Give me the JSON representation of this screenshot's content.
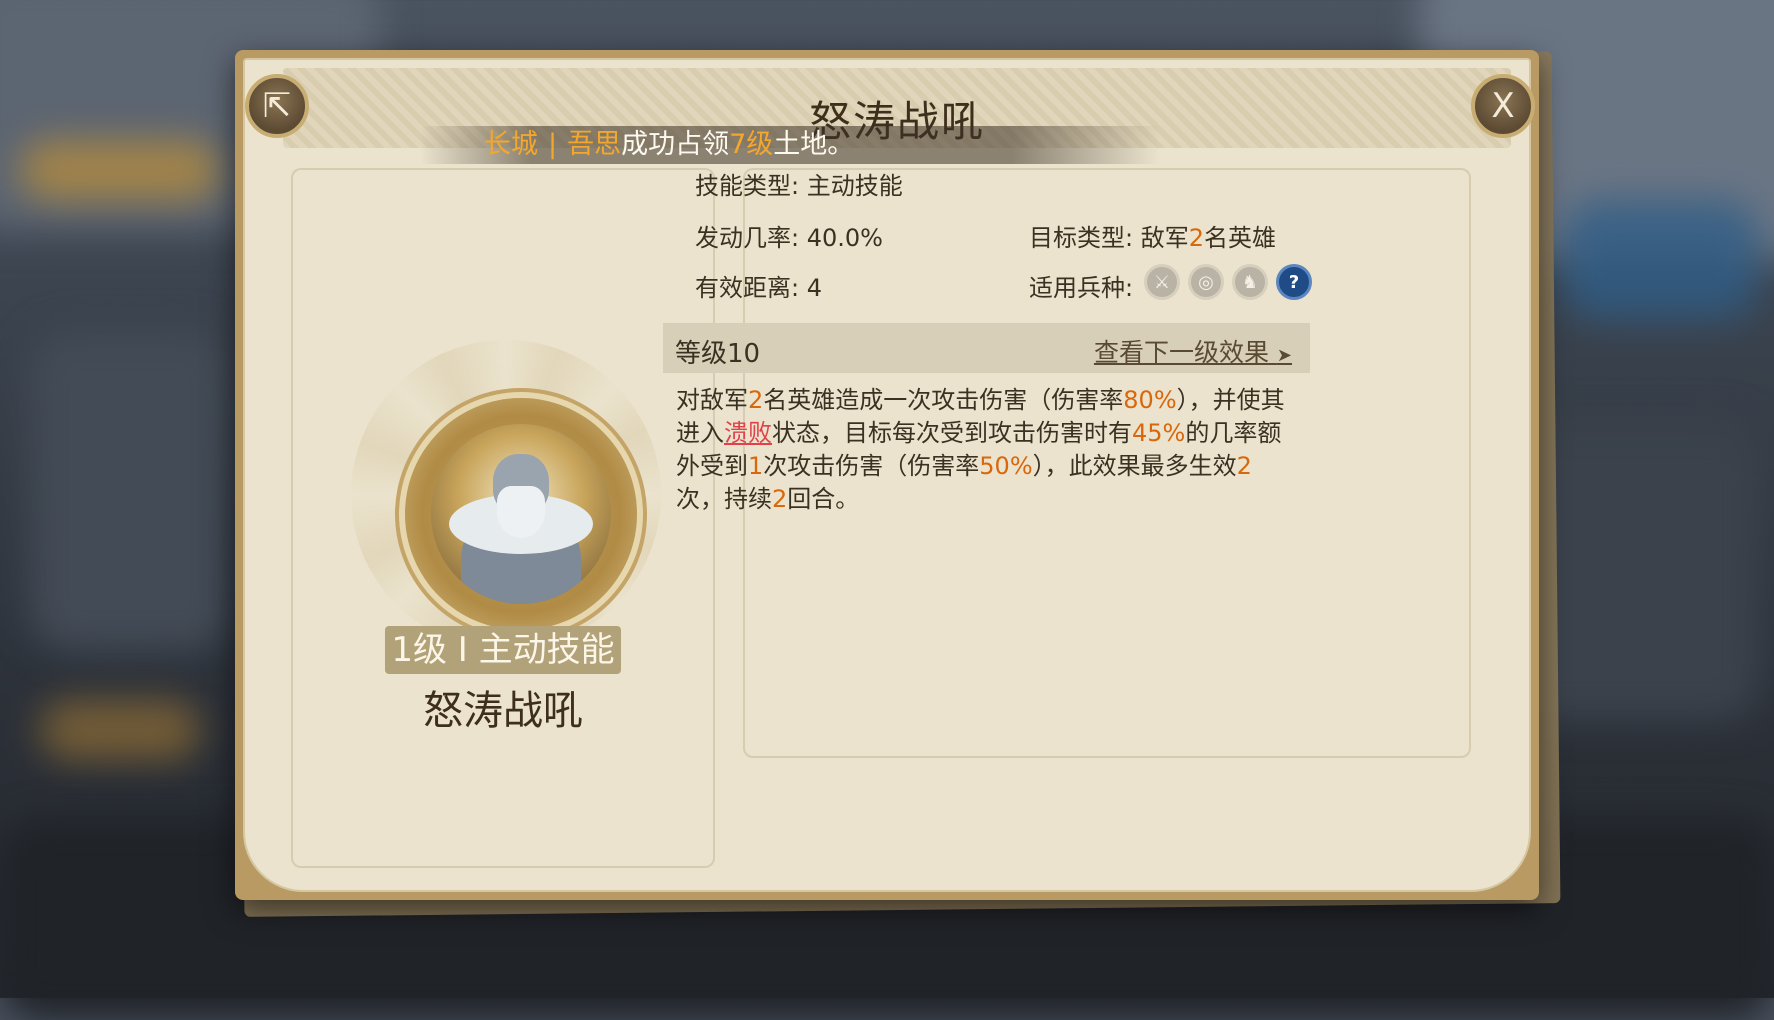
{
  "window": {
    "title": "怒涛战吼"
  },
  "header": {
    "share_icon": "share-icon",
    "close_label": "X"
  },
  "ticker": {
    "player": "长城",
    "separator": "|",
    "name": "吾思",
    "text1": "成功占领",
    "level": "7级",
    "text2": "土地。"
  },
  "skill": {
    "badge": "1级 I 主动技能",
    "name": "怒涛战吼",
    "portrait": "viking-warrior-portrait"
  },
  "attributes": {
    "type_label": "技能类型: ",
    "type_value": "主动技能",
    "chance_label": "发动几率: ",
    "chance_value": "40.0%",
    "target_label": "目标类型: ",
    "target_prefix": "敌军",
    "target_count": "2",
    "target_suffix": "名英雄",
    "range_label": "有效距离: ",
    "range_value": "4",
    "troop_label": "适用兵种: ",
    "troops": [
      "infantry-icon",
      "archer-icon",
      "cavalry-icon",
      "unknown-icon"
    ],
    "troop_glyphs": [
      "⚔",
      "◎",
      "♞",
      "?"
    ]
  },
  "level_bar": {
    "level": "等级10",
    "next_link": "查看下一级效果",
    "arrow": "➤"
  },
  "description": {
    "p1": "对敌军",
    "n1": "2",
    "p2": "名英雄造成一次攻击伤害（伤害率",
    "n2": "80%",
    "p3": "），并使其进入",
    "status": "溃败",
    "p4": "状态，目标每次受到攻击伤害时有",
    "n3": "45%",
    "p5": "的几率额外受到",
    "n4": "1",
    "p6": "次攻击伤害（伤害率",
    "n5": "50%",
    "p7": "），此效果最多生效",
    "n6": "2",
    "p8": "次，持续",
    "n7": "2",
    "p9": "回合。"
  },
  "colors": {
    "highlight": "#d9670b",
    "debuff": "#e0424a",
    "gold": "#f3a72c"
  }
}
